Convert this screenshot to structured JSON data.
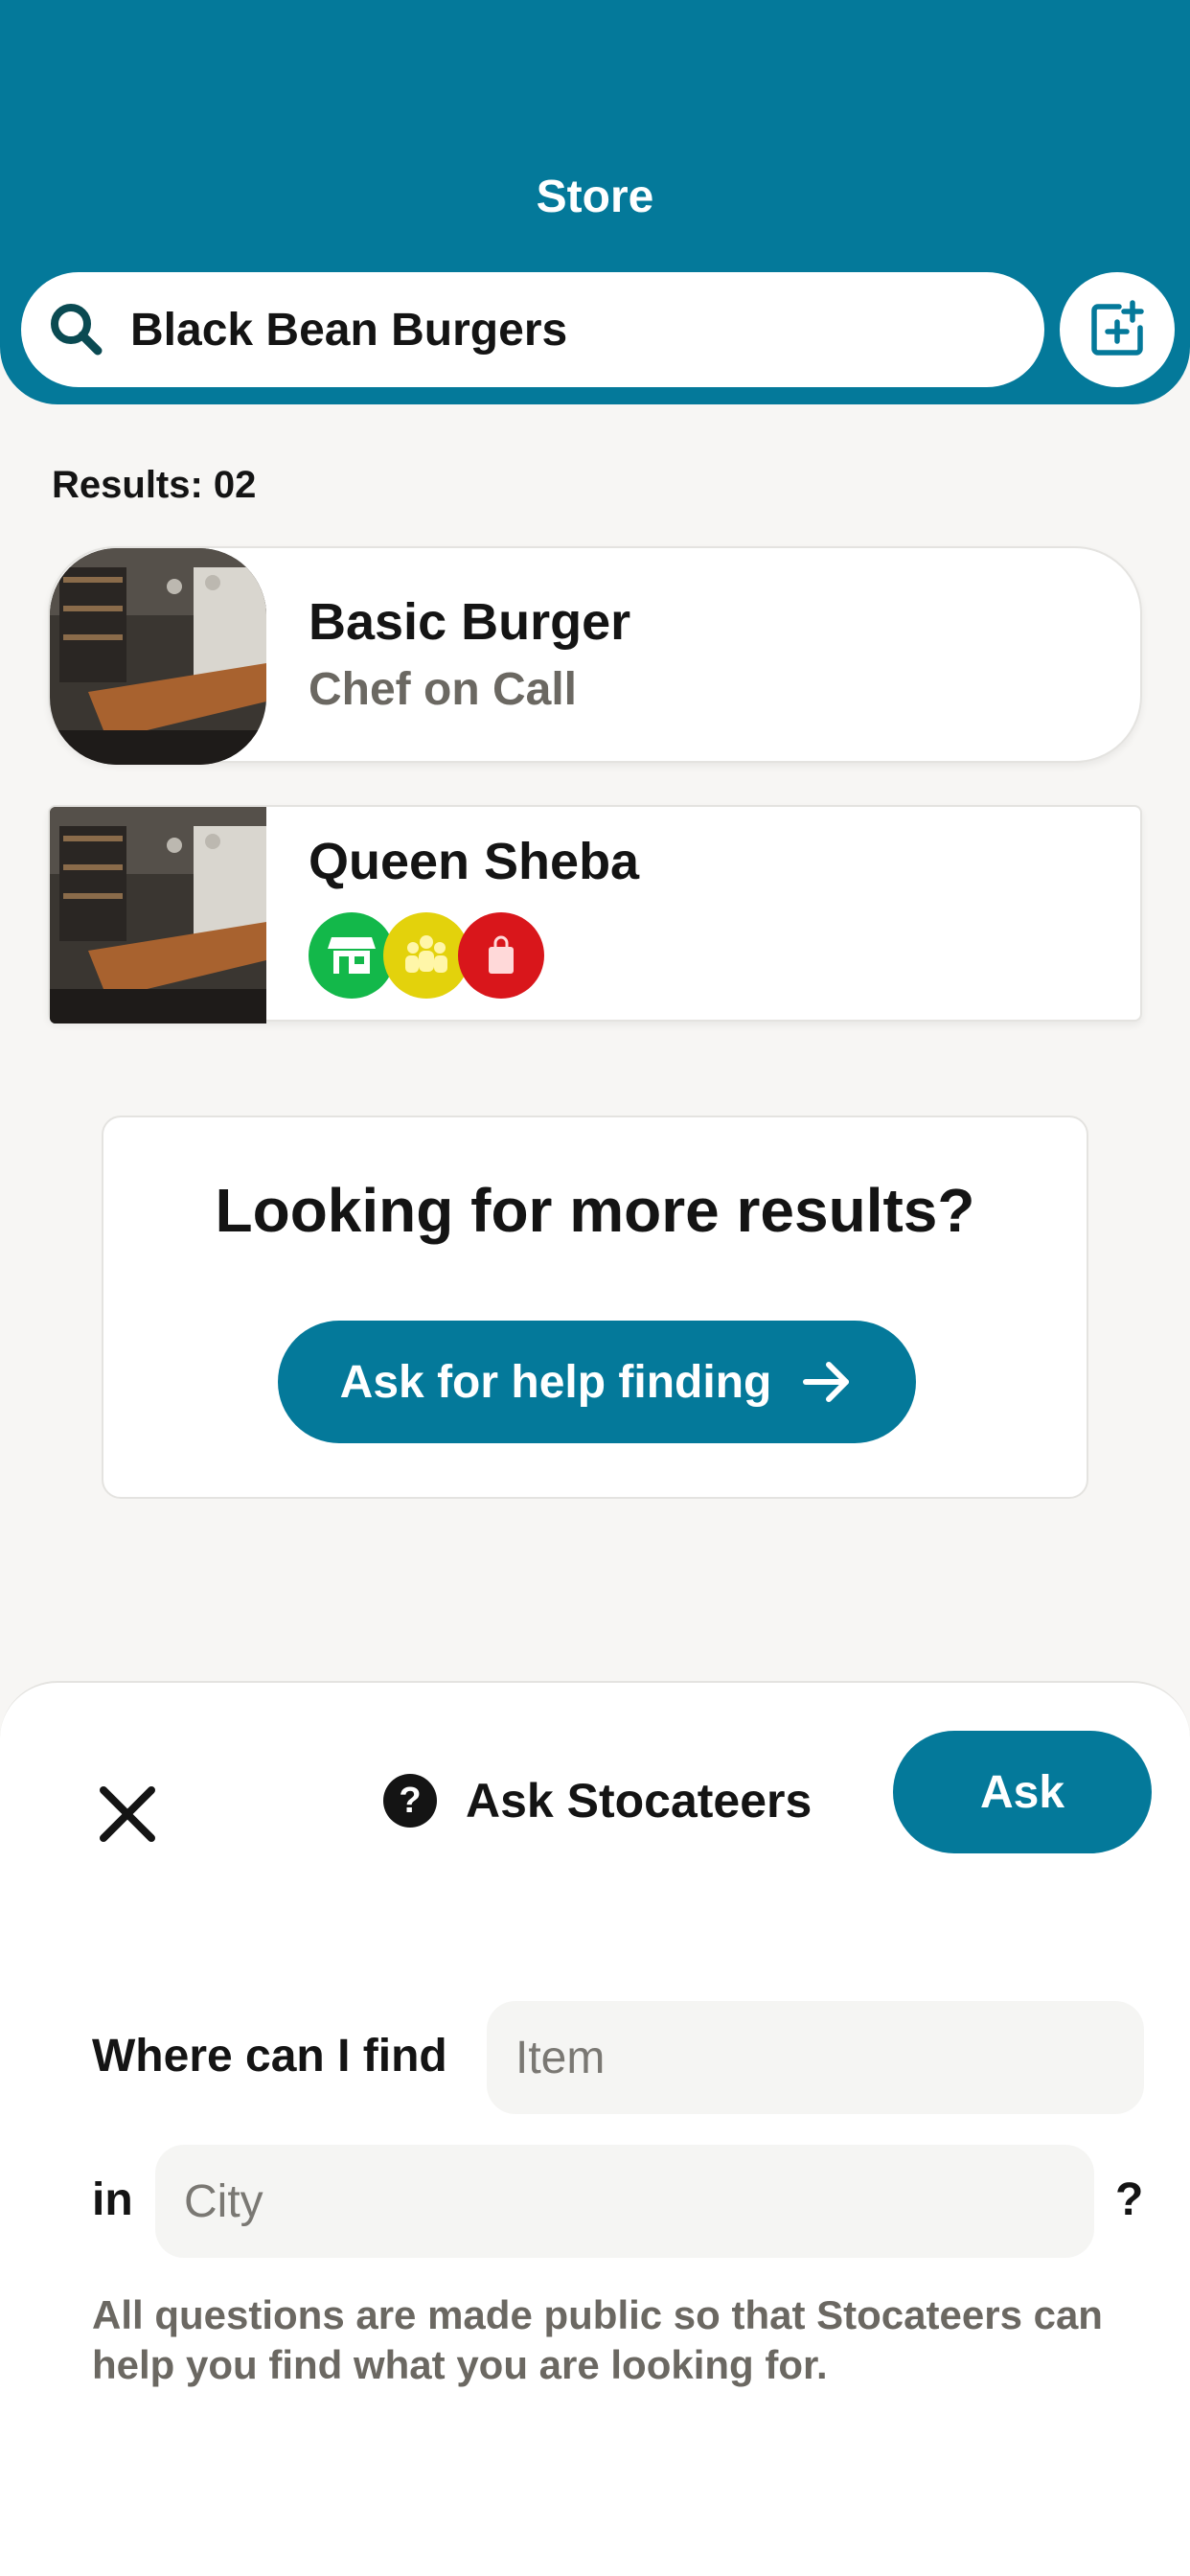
{
  "header": {
    "title": "Store",
    "search_value": "Black Bean Burgers"
  },
  "results": {
    "label": "Results: 02",
    "items": [
      {
        "title": "Basic Burger",
        "subtitle": "Chef on Call"
      },
      {
        "title": "Queen Sheba",
        "badges": [
          "store-icon",
          "group-icon",
          "shopping-bag-icon"
        ]
      }
    ]
  },
  "promo": {
    "title": "Looking for more results?",
    "button_label": "Ask for help finding"
  },
  "sheet": {
    "title": "Ask Stocateers",
    "ask_button": "Ask",
    "where_label": "Where can I find",
    "item_placeholder": "Item",
    "in_label": "in",
    "city_placeholder": "City",
    "question_mark": "?",
    "disclaimer": "All questions are made public so that Stocateers can help you find what you are looking for."
  },
  "colors": {
    "brand": "#04799a",
    "badge_green": "#13b84a",
    "badge_yellow": "#e3d20c",
    "badge_red": "#d9161b"
  }
}
